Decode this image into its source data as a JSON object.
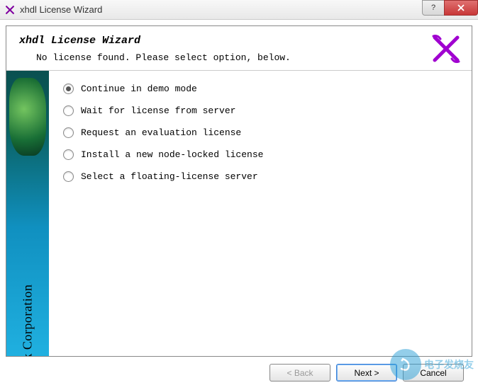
{
  "window": {
    "title": "xhdl License Wizard"
  },
  "header": {
    "title": "xhdl License Wizard",
    "subtitle": "No license found. Please select option, below."
  },
  "sidebar": {
    "company": "X-Tek Corporation"
  },
  "options": [
    {
      "label": "Continue in demo mode",
      "selected": true
    },
    {
      "label": "Wait for license from server",
      "selected": false
    },
    {
      "label": "Request an evaluation license",
      "selected": false
    },
    {
      "label": "Install a new node-locked license",
      "selected": false
    },
    {
      "label": "Select a floating-license server",
      "selected": false
    }
  ],
  "buttons": {
    "back": "< Back",
    "next": "Next >",
    "cancel": "Cancel"
  },
  "watermark": {
    "text": "电子发烧友"
  }
}
